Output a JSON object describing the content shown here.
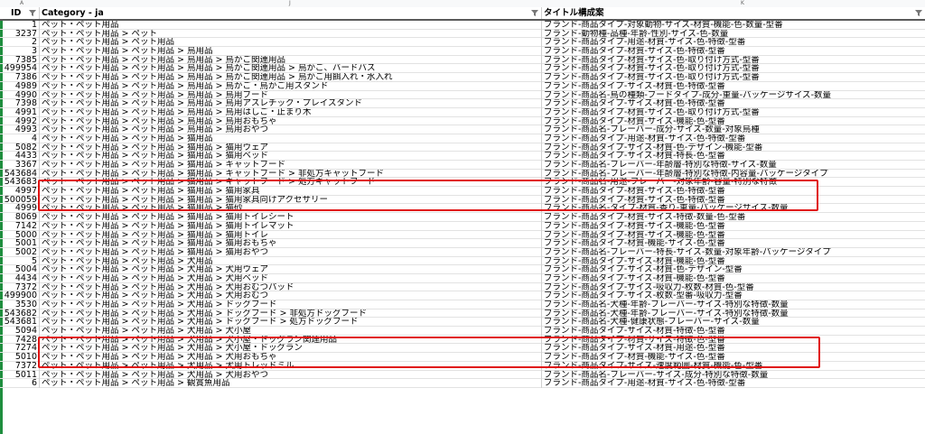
{
  "column_letters": {
    "a": "A",
    "j": "J",
    "k": "K"
  },
  "headers": {
    "id": "ID",
    "category": "Category - ja",
    "title": "タイトル構成案"
  },
  "rows": [
    {
      "id": "1",
      "category": "ペット・ペット用品",
      "title": "ブランド-商品タイプ-対象動物-サイズ-材質-機能-色-数量-型番"
    },
    {
      "id": "3237",
      "category": "ペット・ペット用品 > ペット",
      "title": "ブランド-動物種-品種-年齢-性別-サイズ-色-数量"
    },
    {
      "id": "2",
      "category": "ペット・ペット用品 > ペット用品",
      "title": "ブランド-商品タイプ-用途-材質-サイズ-色-特徴-型番"
    },
    {
      "id": "3",
      "category": "ペット・ペット用品 > ペット用品 > 鳥用品",
      "title": "ブランド-商品タイプ-材質-サイズ-色-特徴-型番"
    },
    {
      "id": "7385",
      "category": "ペット・ペット用品 > ペット用品 > 鳥用品 > 鳥かご関連用品",
      "title": "ブランド-商品タイプ-材質-サイズ-色-取り付け方式-型番"
    },
    {
      "id": "499954",
      "category": "ペット・ペット用品 > ペット用品 > 鳥用品 > 鳥かご関連用品 > 鳥かご、バードバス",
      "title": "ブランド-商品タイプ-材質-サイズ-色-取り付け方式-型番"
    },
    {
      "id": "7386",
      "category": "ペット・ペット用品 > ペット用品 > 鳥用品 > 鳥かご関連用品 > 鳥かご用餌入れ・水入れ",
      "title": "ブランド-商品タイプ-材質-サイズ-色-取り付け方式-型番"
    },
    {
      "id": "4989",
      "category": "ペット・ペット用品 > ペット用品 > 鳥用品 > 鳥かご・鳥かご用スタンド",
      "title": "ブランド-商品タイプ-サイズ-材質-色-特徴-型番"
    },
    {
      "id": "4990",
      "category": "ペット・ペット用品 > ペット用品 > 鳥用品 > 鳥用フード",
      "title": "ブランド-商品名-鳥の種類-フードタイプ-成分-重量-パッケージサイズ-数量"
    },
    {
      "id": "7398",
      "category": "ペット・ペット用品 > ペット用品 > 鳥用品 > 鳥用アスレチック・プレイスタンド",
      "title": "ブランド-商品タイプ-サイズ-材質-色-特徴-型番"
    },
    {
      "id": "4991",
      "category": "ペット・ペット用品 > ペット用品 > 鳥用品 > 鳥用はしご・止まり木",
      "title": "ブランド-商品タイプ-材質-サイズ-色-取り付け方式-型番"
    },
    {
      "id": "4992",
      "category": "ペット・ペット用品 > ペット用品 > 鳥用品 > 鳥用おもちゃ",
      "title": "ブランド-商品タイプ-材質-サイズ-機能-色-型番"
    },
    {
      "id": "4993",
      "category": "ペット・ペット用品 > ペット用品 > 鳥用品 > 鳥用おやつ",
      "title": "ブランド-商品名-フレーバー-成分-サイズ-数量-対象鳥種"
    },
    {
      "id": "4",
      "category": "ペット・ペット用品 > ペット用品 > 猫用品",
      "title": "ブランド-商品タイプ-用途-材質-サイズ-色-特徴-型番"
    },
    {
      "id": "5082",
      "category": "ペット・ペット用品 > ペット用品 > 猫用品 > 猫用ウェア",
      "title": "ブランド-商品タイプ-サイズ-材質-色-デザイン-機能-型番"
    },
    {
      "id": "4433",
      "category": "ペット・ペット用品 > ペット用品 > 猫用品 > 猫用ベッド",
      "title": "ブランド-商品タイプ-サイズ-材質-特長-色-型番"
    },
    {
      "id": "3367",
      "category": "ペット・ペット用品 > ペット用品 > 猫用品 > キャットフード",
      "title": "ブランド-商品名-フレーバー-年齢層-特別な特徴-サイズ-数量"
    },
    {
      "id": "543684",
      "category": "ペット・ペット用品 > ペット用品 > 猫用品 > キャットフード > 非処方キャットフード",
      "title": "ブランド-商品名-フレーバー-年齢層-特別な特徴-内容量-パッケージタイプ"
    },
    {
      "id": "543683",
      "category": "ペット・ペット用品 > ペット用品 > 猫用品 > キャットフード > 処方キャットフード",
      "title": "ブランド-商品名-用途-フレーバー-対象年齢-容量-特別な特徴"
    },
    {
      "id": "4997",
      "category": "ペット・ペット用品 > ペット用品 > 猫用品 > 猫用家具",
      "title": "ブランド-商品タイプ-材質-サイズ-色-特徴-型番"
    },
    {
      "id": "500059",
      "category": "ペット・ペット用品 > ペット用品 > 猫用品 > 猫用家具向けアクセサリー",
      "title": "ブランド-商品タイプ-材質-サイズ-色-特徴-型番"
    },
    {
      "id": "4999",
      "category": "ペット・ペット用品 > ペット用品 > 猫用品 > 猫砂",
      "title": "ブランド-商品名-タイプ-材質-香り-重量-パッケージサイズ-数量"
    },
    {
      "id": "8069",
      "category": "ペット・ペット用品 > ペット用品 > 猫用品 > 猫用トイレシート",
      "title": "ブランド-商品タイプ-材質-サイズ-特徴-数量-色-型番"
    },
    {
      "id": "7142",
      "category": "ペット・ペット用品 > ペット用品 > 猫用品 > 猫用トイレマット",
      "title": "ブランド-商品タイプ-材質-サイズ-機能-色-型番"
    },
    {
      "id": "5000",
      "category": "ペット・ペット用品 > ペット用品 > 猫用品 > 猫用トイレ",
      "title": "ブランド-商品タイプ-材質-サイズ-機能-色-型番"
    },
    {
      "id": "5001",
      "category": "ペット・ペット用品 > ペット用品 > 猫用品 > 猫用おもちゃ",
      "title": "ブランド-商品タイプ-材質-機能-サイズ-色-型番"
    },
    {
      "id": "5002",
      "category": "ペット・ペット用品 > ペット用品 > 猫用品 > 猫用おやつ",
      "title": "ブランド-商品名-フレーバー-特長-サイズ-数量-対象年齢-パッケージタイプ"
    },
    {
      "id": "5",
      "category": "ペット・ペット用品 > ペット用品 > 犬用品",
      "title": "ブランド-商品タイプ-サイズ-材質-機能-色-型番"
    },
    {
      "id": "5004",
      "category": "ペット・ペット用品 > ペット用品 > 犬用品 > 犬用ウェア",
      "title": "ブランド-商品タイプ-サイズ-材質-色-デザイン-型番"
    },
    {
      "id": "4434",
      "category": "ペット・ペット用品 > ペット用品 > 犬用品 > 犬用ベッド",
      "title": "ブランド-商品タイプ-サイズ-材質-機能-色-型番"
    },
    {
      "id": "7372",
      "category": "ペット・ペット用品 > ペット用品 > 犬用品 > 犬用おむつパッド",
      "title": "ブランド-商品タイプ-サイズ-吸収力-枚数-材質-色-型番"
    },
    {
      "id": "499900",
      "category": "ペット・ペット用品 > ペット用品 > 犬用品 > 犬用おむつ",
      "title": "ブランド-商品タイプ-サイズ-枚数-型番-吸収力-型番"
    },
    {
      "id": "3530",
      "category": "ペット・ペット用品 > ペット用品 > 犬用品 > ドッグフード",
      "title": "ブランド-商品名-犬種-年齢-フレーバー-サイズ-特別な特徴-数量"
    },
    {
      "id": "543682",
      "category": "ペット・ペット用品 > ペット用品 > 犬用品 > ドッグフード > 非処方ドッグフード",
      "title": "ブランド-商品名-犬種-年齢-フレーバー-サイズ-特別な特徴-数量"
    },
    {
      "id": "543681",
      "category": "ペット・ペット用品 > ペット用品 > 犬用品 > ドッグフード > 処方ドッグフード",
      "title": "ブランド-商品名-犬種-健康状態-フレーバー-サイズ-数量"
    },
    {
      "id": "5094",
      "category": "ペット・ペット用品 > ペット用品 > 犬用品 > 犬小屋",
      "title": "ブランド-商品タイプ-サイズ-材質-特徴-色-型番"
    },
    {
      "id": "7428",
      "category": "ペット・ペット用品 > ペット用品 > 犬用品 > 犬小屋・ドッグラン関連用品",
      "title": "ブランド-商品タイプ-材質-サイズ-特徴-色-型番"
    },
    {
      "id": "7274",
      "category": "ペット・ペット用品 > ペット用品 > 犬用品 > 犬小屋・ドッグラン",
      "title": "ブランド-商品タイプ-サイズ-材質-用途-色-型番"
    },
    {
      "id": "5010",
      "category": "ペット・ペット用品 > ペット用品 > 犬用品 > 犬用おもちゃ",
      "title": "ブランド-商品タイプ-材質-機能-サイズ-色-型番"
    },
    {
      "id": "7372",
      "category": "ペット・ペット用品 > ペット用品 > 犬用品 > 犬用トレッドミル",
      "title": "ブランド-商品タイプ-サイズ-速度範囲-材質-機能-色-型番"
    },
    {
      "id": "5011",
      "category": "ペット・ペット用品 > ペット用品 > 犬用品 > 犬用おやつ",
      "title": "ブランド-商品名-フレーバー-サイズ-成分-特別な特徴-数量"
    },
    {
      "id": "6",
      "category": "ペット・ペット用品 > ペット用品 > 観賞魚用品",
      "title": "ブランド-商品タイプ-用途-材質-サイズ-色-特徴-型番"
    }
  ]
}
